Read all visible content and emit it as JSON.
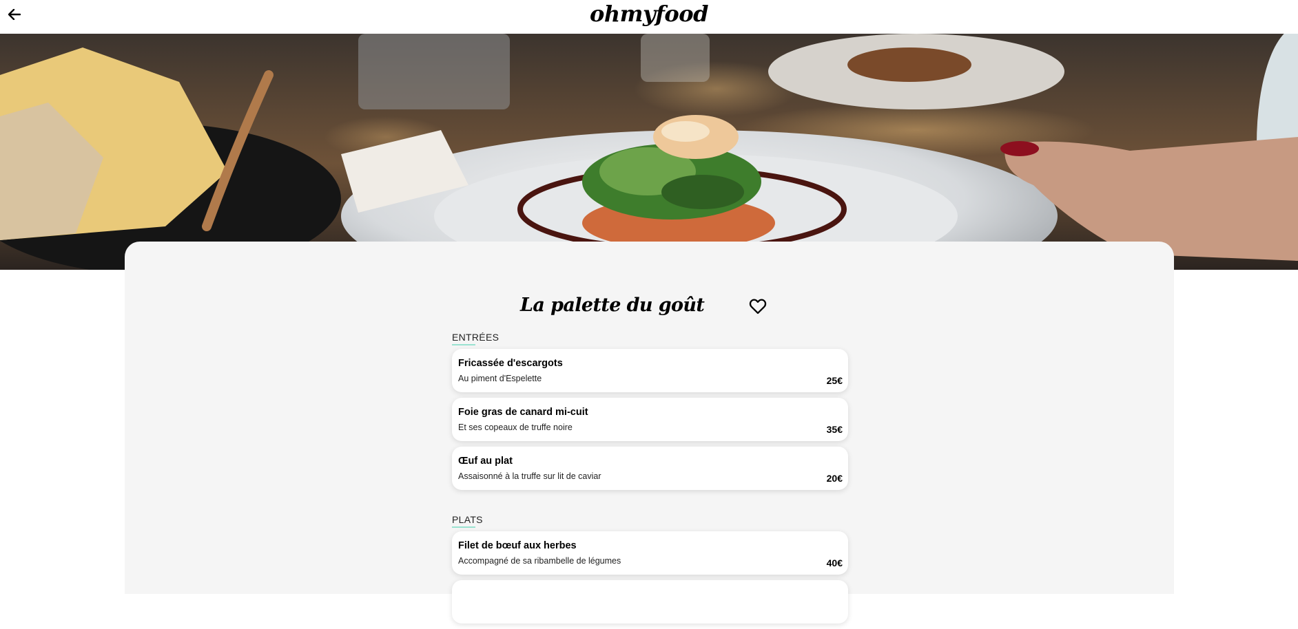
{
  "header": {
    "logo": "ohmyfood"
  },
  "restaurant": {
    "name": "La palette du goût"
  },
  "sections": [
    {
      "label": "ENTRÉES",
      "dishes": [
        {
          "name": "Fricassée d'escargots",
          "description": "Au piment d'Espelette",
          "price": "25€"
        },
        {
          "name": "Foie gras de canard mi-cuit",
          "description": "Et ses copeaux de truffe noire",
          "price": "35€"
        },
        {
          "name": "Œuf au plat",
          "description": "Assaisonné à la truffe sur lit de caviar",
          "price": "20€"
        }
      ]
    },
    {
      "label": "PLATS",
      "dishes": [
        {
          "name": "Filet de bœuf aux herbes",
          "description": "Accompagné de sa ribambelle de légumes",
          "price": "40€"
        }
      ]
    }
  ],
  "icons": {
    "back": "arrow-left-icon",
    "favorite": "heart-outline-icon"
  },
  "colors": {
    "accent_underline": "#99e2d0",
    "card_background": "#f5f5f5"
  }
}
